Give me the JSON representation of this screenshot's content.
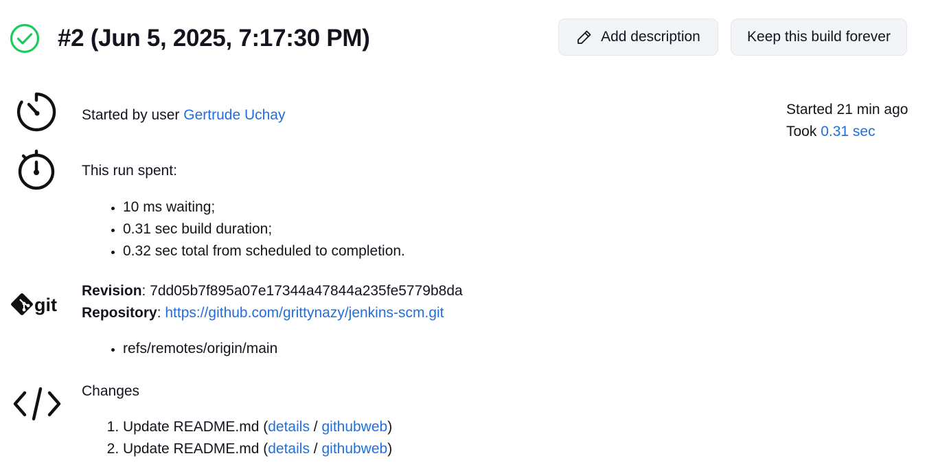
{
  "header": {
    "title": "#2 (Jun 5, 2025, 7:17:30 PM)",
    "add_description_label": "Add description",
    "keep_forever_label": "Keep this build forever"
  },
  "cause": {
    "prefix": "Started by user ",
    "user": "Gertrude Uchay"
  },
  "timing": {
    "started": "Started 21 min ago",
    "took_prefix": "Took ",
    "took_value": "0.31 sec"
  },
  "run_spent": {
    "heading": "This run spent:",
    "items": [
      "10 ms waiting;",
      "0.31 sec build duration;",
      "0.32 sec total from scheduled to completion."
    ]
  },
  "git": {
    "revision_label": "Revision",
    "revision_value": "7dd05b7f895a07e17344a47844a235fe5779b8da",
    "repository_label": "Repository",
    "repository_url": "https://github.com/grittynazy/jenkins-scm.git",
    "refs": [
      "refs/remotes/origin/main"
    ]
  },
  "changes": {
    "heading": "Changes",
    "items": [
      {
        "text": "Update README.md",
        "details": "details",
        "sep": "/",
        "web": "githubweb"
      },
      {
        "text": "Update README.md",
        "details": "details",
        "sep": "/",
        "web": "githubweb"
      }
    ]
  },
  "colors": {
    "success": "#1ec95b",
    "link": "#1f6fe0",
    "button_bg": "#f2f4f7"
  },
  "icons": {
    "status": "check-circle-icon",
    "edit": "pencil-icon",
    "cause": "clock-icon",
    "timer": "stopwatch-icon",
    "scm": "git-icon",
    "changes": "code-icon"
  }
}
